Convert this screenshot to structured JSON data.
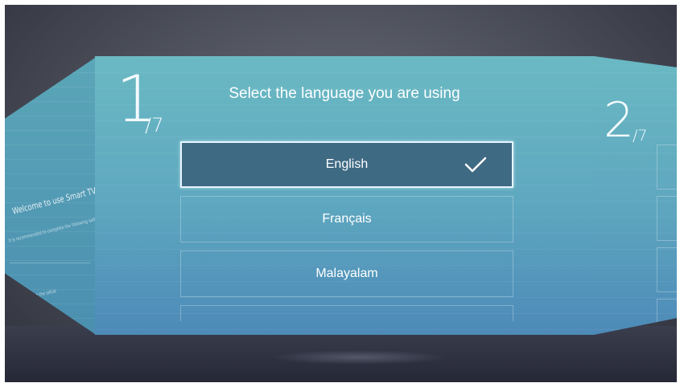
{
  "welcome_panel": {
    "title": "Welcome to use Smart TV",
    "subtitle": "It is recommended to complete the following settings",
    "link": "Start the setup"
  },
  "setup": {
    "current_step": "1",
    "total_steps": "/7",
    "title": "Select the language you are using",
    "languages": [
      {
        "label": "English",
        "selected": true
      },
      {
        "label": "Français",
        "selected": false
      },
      {
        "label": "Malayalam",
        "selected": false
      }
    ]
  },
  "next_panel": {
    "step": "2",
    "total_steps": "/7"
  },
  "icons": {
    "selected_indicator": "checkmark-icon"
  },
  "colors": {
    "panel_top": "#6ab9c3",
    "panel_bottom": "#4d8ab8",
    "selected_bg": "#3f6a84",
    "selected_border": "#e6f6ff"
  }
}
